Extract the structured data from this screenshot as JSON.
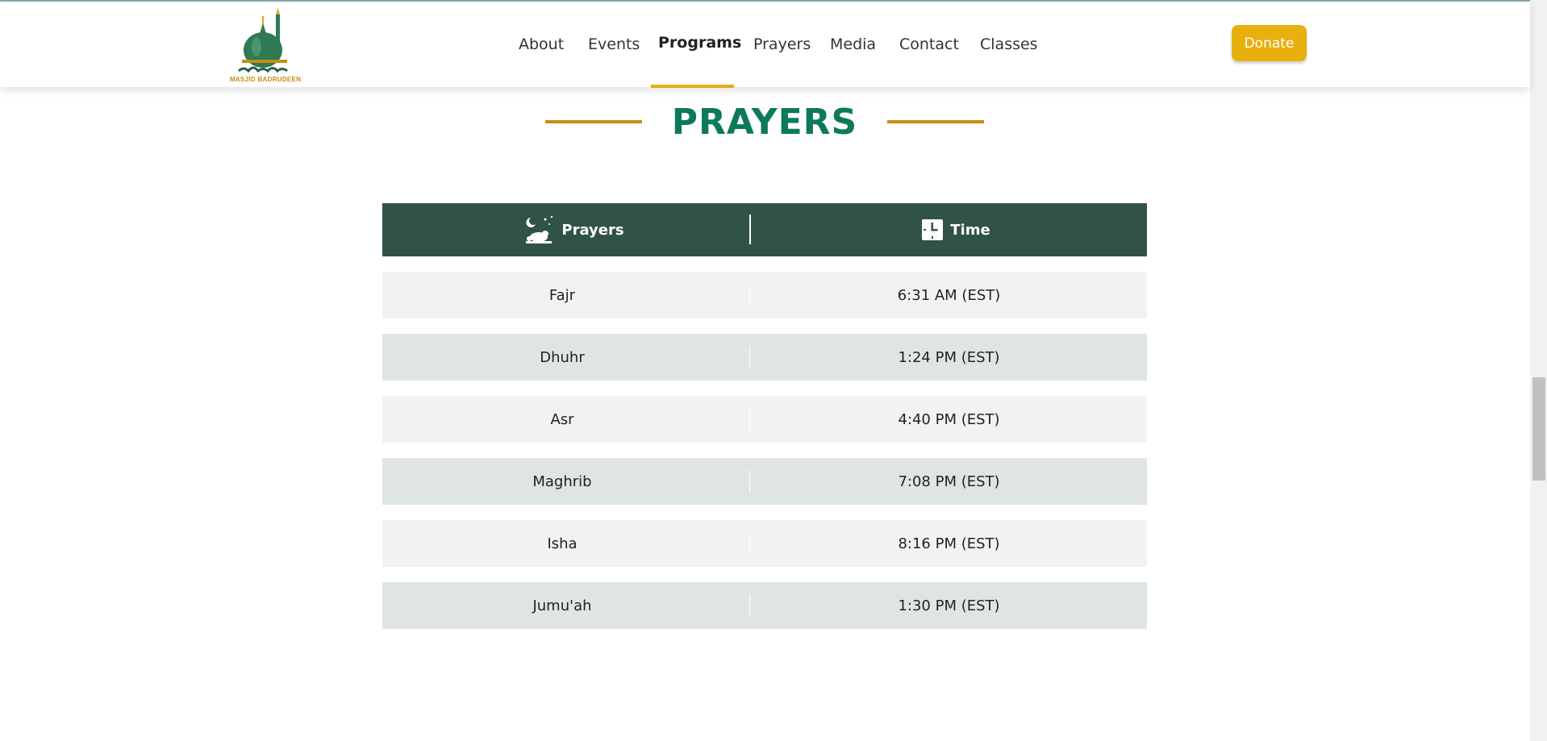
{
  "header": {
    "logo_text": "MASJID BADRUDEEN",
    "nav": [
      "About",
      "Events",
      "Programs",
      "Prayers",
      "Media",
      "Contact",
      "Classes"
    ],
    "active_nav": "Programs",
    "donate_label": "Donate"
  },
  "section": {
    "title": "PRAYERS"
  },
  "table": {
    "headers": {
      "prayer": "Prayers",
      "time": "Time"
    },
    "rows": [
      {
        "prayer": "Fajr",
        "time": "6:31 AM (EST)"
      },
      {
        "prayer": "Dhuhr",
        "time": "1:24 PM (EST)"
      },
      {
        "prayer": "Asr",
        "time": "4:40 PM (EST)"
      },
      {
        "prayer": "Maghrib",
        "time": "7:08 PM (EST)"
      },
      {
        "prayer": "Isha",
        "time": "8:16 PM (EST)"
      },
      {
        "prayer": "Jumu'ah",
        "time": "1:30 PM (EST)"
      }
    ]
  },
  "icons": {
    "prayer_header": "praying-person-icon",
    "time_header": "clock-icon"
  },
  "colors": {
    "brand_green": "#0c7a5a",
    "table_header": "#315346",
    "accent_gold": "#e8b00d",
    "title_line": "#c98d12"
  }
}
